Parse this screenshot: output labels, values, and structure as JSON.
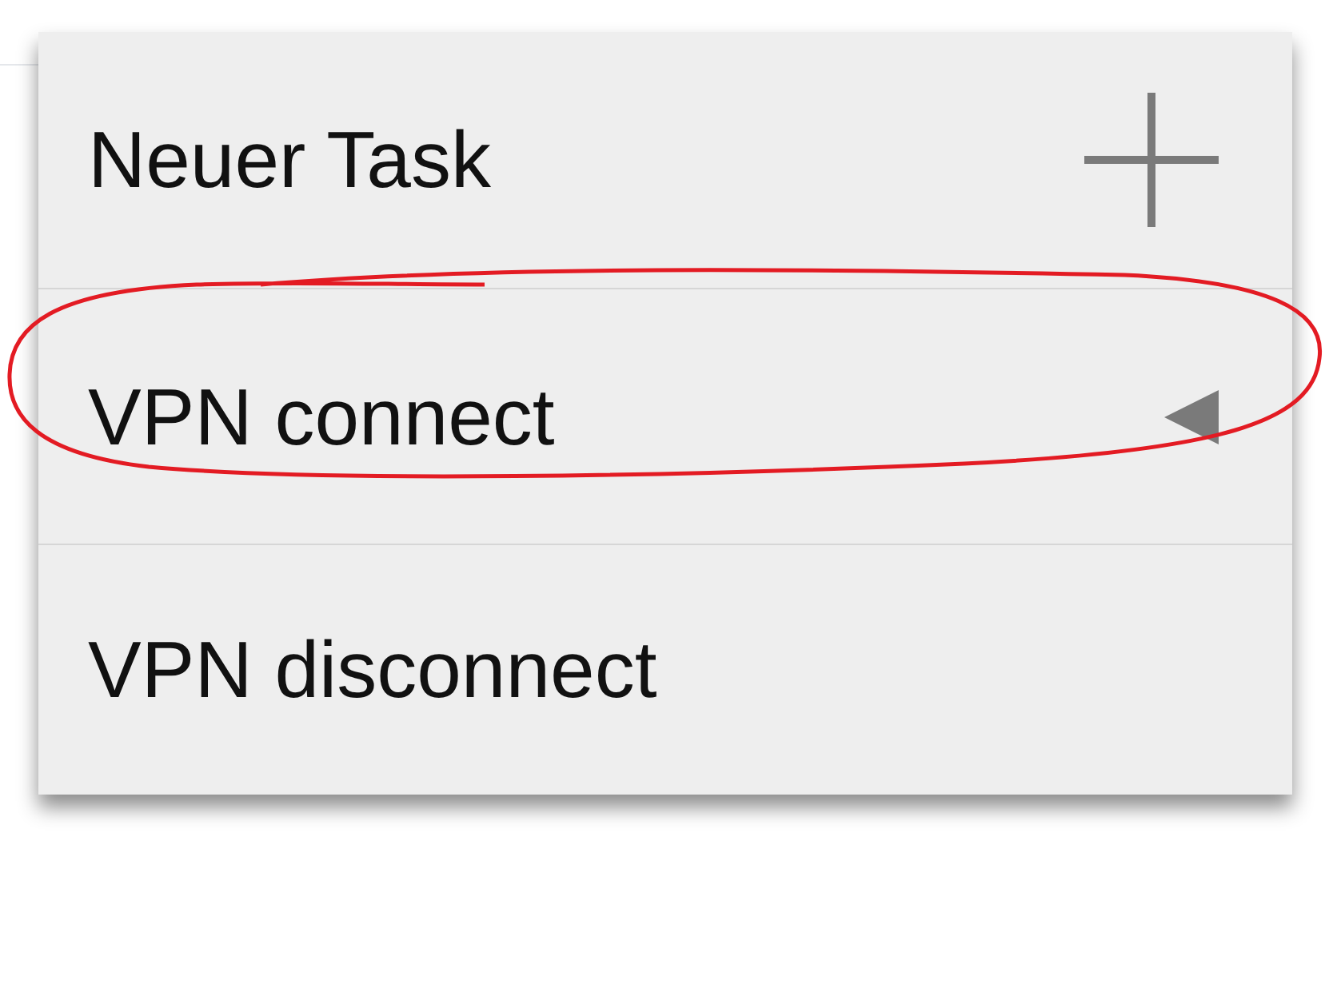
{
  "menu": {
    "items": [
      {
        "label": "Neuer Task",
        "kind": "add",
        "highlighted": false
      },
      {
        "label": "VPN connect",
        "kind": "submenu",
        "highlighted": true
      },
      {
        "label": "VPN disconnect",
        "kind": "plain",
        "highlighted": false
      }
    ]
  }
}
